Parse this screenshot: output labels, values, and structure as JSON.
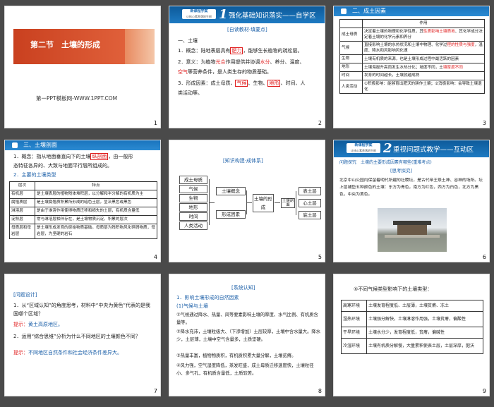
{
  "s1": {
    "title": "第二节　土壤的形成",
    "subtitle": "第一PPT模板网-WWW.1PPT.COM",
    "num": "1"
  },
  "logo": {
    "a": "新课程学案",
    "b": "让核心素养落地生根"
  },
  "s2": {
    "badge": "1",
    "heading": "强化基础知识落实——自学区",
    "section": "[自读教材·填要点]",
    "h1": "一、土壤",
    "l1a": "1．概念：陆地表层具有",
    "l1b": "肥力",
    "l1c": "，能够生长植物的疏松层。",
    "l2a": "2．意义：为植物",
    "l2b": "光合",
    "l2c": "作用提供并协调",
    "l2d": "水分",
    "l2e": "、养分、温度、",
    "l3a": "",
    "l3b": "空气",
    "l3c": "等营养条件，是人类生存的物质基础。",
    "l4a": "3．形成因素：成土母质、",
    "l4b": "气候",
    "l4c": "、生物、",
    "l4d": "地形",
    "l4e": "、时间、人",
    "l5": "类活动等。",
    "num": "2"
  },
  "s3": {
    "heading": "二、成土因素",
    "col1": "",
    "col2": "作用",
    "rows": [
      {
        "k": "成土母质",
        "v1": "决定着土壤的物理和化学性质，其",
        "v2": "性质影响土壤质地",
        "v3": "、其化学成分决定着土壤的化学元素和养分"
      },
      {
        "k": "气候",
        "v1": "直接影响土壤的水热状况和土壤中物理、化学过",
        "v2": "程的性质与强度",
        "v3": "，温度、降水和风影响风化速"
      },
      {
        "k": "生物",
        "v1": "土壤有机质的来源，也是土壤形成过程中最活跃",
        "v2": "的因素",
        "v3": ""
      },
      {
        "k": "地形",
        "v1": "土壤海拔升高而发生水热分化；坡度不同，土",
        "v2": "壤厚度不同",
        "v3": ""
      },
      {
        "k": "时间",
        "v1": "发育的时间越长，土壤就越成熟",
        "v2": "",
        "v3": ""
      },
      {
        "k": "人类活动",
        "v1": "①积极影响：能够育出肥沃的耕作土壤；②消极",
        "v2": "影响：会导致土壤退化",
        "v3": ""
      }
    ],
    "num": "3"
  },
  "s4": {
    "h1": "三、土壤剖面",
    "l1a": "1．概念：指从地面垂直向下的土壤",
    "l1b": "纵剖面",
    "l1c": "，由一般形",
    "l2": "态特征各异的、大致与地面平行层所组成的。",
    "h2": "2．主要的土壤类型",
    "c1": "层次",
    "c2": "特点",
    "rows": [
      {
        "k": "有机层",
        "v": "是土壤表层的植物残体堆积层，以分解和半分解的有机质为主"
      },
      {
        "k": "腐殖质层",
        "v": "是土壤腐殖质积累所形成的暗色土层，呈灰黑色或黑色"
      },
      {
        "k": "淋溶层",
        "v": "是由于淋溶作用使得物质迁移和损失的土层，有机质含量低"
      },
      {
        "k": "淀积层",
        "v": "常与淋溶层相伴存在，是土壤物质沉淀、积累的层次"
      },
      {
        "k": "母质层和母岩层",
        "v": "是土壤形成发育的原始物质基础。母质层为残积物风化碎屑物质，母岩层，为坚硬的岩石"
      }
    ],
    "num": "4"
  },
  "s5": {
    "heading": "[知识构建·成体系]",
    "left": [
      "成土母质",
      "气候",
      "生物",
      "地形",
      "时间",
      "人类活动"
    ],
    "mid1": "土壤概念",
    "mid2": "形成因素",
    "center": "土壤的形成",
    "profile": "土壤剖面",
    "right": [
      "表土层",
      "心土层",
      "底土层"
    ],
    "num": "5"
  },
  "s6": {
    "badge": "2",
    "heading": "重视问题式教学——互动区",
    "q": "问题探究　土壤的主要形成因素有哪些(重难考点)",
    "sub": "[思考探究]",
    "p1": "北京中山公园内保留着明代所建的社稷坛，是古代帝王祭土神、谷神的场所。坛上层铺垫五种颜色的土壤：东方为青色，",
    "p2": "南方为红色，西方为白色，北方为黑色，中央为黄色。",
    "num": "6"
  },
  "s7": {
    "h": "[问题设计]",
    "q1": "1．从“区域认知”的角度思考，材料中“中央为黄色”代表的是我国哪个区域？",
    "a1k": "提示：",
    "a1": "黄土高原地区。",
    "q2": "2．运用“综合思维”分析为什么不同地区的土壤颜色不同？",
    "a2k": "提示：",
    "a2": "不同地区自然条件和社会经济条件差异大。",
    "num": "7"
  },
  "s8": {
    "h": "[系统认知]",
    "h1": "1．影响土壤形成的自然因素",
    "h2": "(1)气候与土壤",
    "l1": "①气候通过降水、热量、风等要素影响土壤的厚度、水气比例、有机质含量等。",
    "l2": "②降水充沛，土壤粒级大、（下渗增加）土层较厚，土壤中含水量大。降水少，土层薄，土壤中空气含量多，土质坚硬。",
    "l3": "③热量丰富，植物物质积，有机质积累大量分解，土壤贫瘠。",
    "l4": "④风力强，空气湿度降低，蒸发旺盛，成土母质迁移速度快，土壤粒径小、多气孔，有机质含量低，土质较差。",
    "num": "8"
  },
  "s9": {
    "h": "⑤不同气候类型影响下的土壤类型：",
    "rows": [
      {
        "k": "高寒环境",
        "v": "土壤发育程度低、土层薄，土壤贫瘠、冻土"
      },
      {
        "k": "湿热环境",
        "v": "土壤强分解快，土壤淋溶作用强，土壤贫瘠，偏酸性"
      },
      {
        "k": "干旱环境",
        "v": "土壤水分少，发育程度低，贫瘠，偏碱性"
      },
      {
        "k": "冷湿环境",
        "v": "土壤有机质分解慢，大量累积使表土层，土层深厚，肥沃"
      }
    ],
    "num": "9"
  },
  "colors": {
    "accent": "#d94a2b",
    "blue": "#1b6bb3",
    "highlight": "#e02020"
  }
}
